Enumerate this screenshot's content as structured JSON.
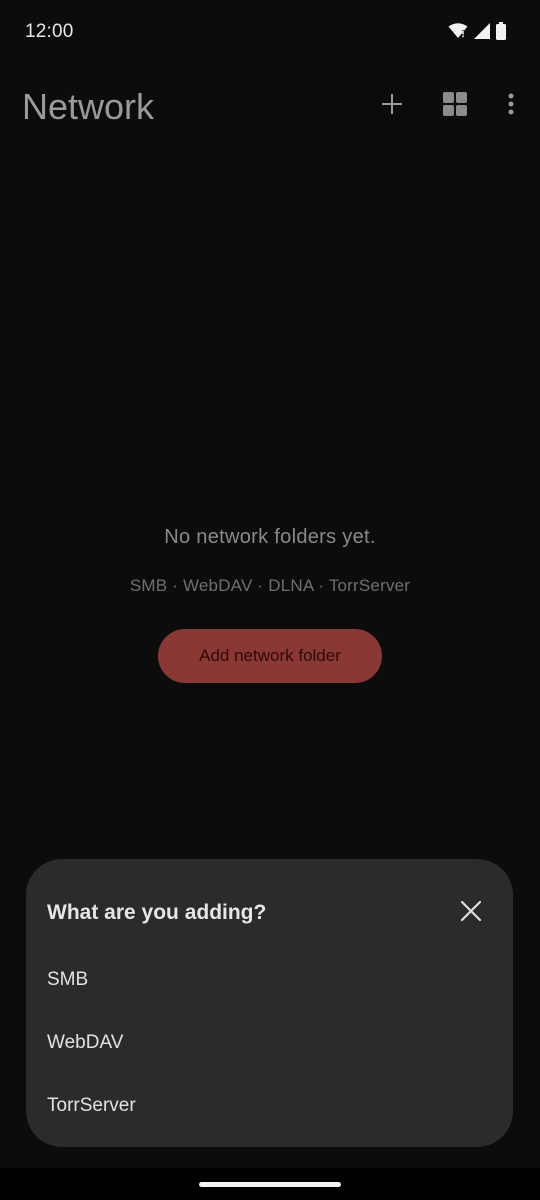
{
  "status_bar": {
    "time": "12:00",
    "icons": [
      "wifi-icon",
      "signal-icon",
      "battery-icon"
    ]
  },
  "app_bar": {
    "title": "Network",
    "actions": [
      "add-icon",
      "grid-view-icon",
      "more-vert-icon"
    ]
  },
  "empty_state": {
    "title": "No network folders yet.",
    "subtitle": "SMB · WebDAV · DLNA · TorrServer",
    "button_label": "Add network folder"
  },
  "sheet": {
    "title": "What are you adding?",
    "items": [
      {
        "label": "SMB"
      },
      {
        "label": "WebDAV"
      },
      {
        "label": "TorrServer"
      }
    ]
  },
  "colors": {
    "background": "#0b0c0c",
    "sheet": "#2a2c2c",
    "accent_button": "#8a3834"
  }
}
